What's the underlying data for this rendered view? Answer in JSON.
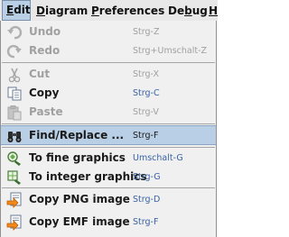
{
  "menubar": {
    "items": [
      {
        "label": "Edit",
        "mnemonic_prefix": "",
        "mnemonic": "E",
        "rest": "dit",
        "active": true
      },
      {
        "label": "Diagram",
        "mnemonic_prefix": "",
        "mnemonic": "D",
        "rest": "iagram"
      },
      {
        "label": "Preferences",
        "mnemonic_prefix": "",
        "mnemonic": "P",
        "rest": "references"
      },
      {
        "label": "Debug",
        "mnemonic_prefix": "De",
        "mnemonic": "b",
        "rest": "ug"
      },
      {
        "label": "H",
        "mnemonic_prefix": "",
        "mnemonic": "H",
        "rest": ""
      }
    ]
  },
  "menu": {
    "undo": {
      "label": "Undo",
      "accel": "Strg-Z",
      "enabled": false
    },
    "redo": {
      "label": "Redo",
      "accel": "Strg+Umschalt-Z",
      "enabled": false
    },
    "cut": {
      "label": "Cut",
      "accel": "Strg-X",
      "enabled": false
    },
    "copy": {
      "label": "Copy",
      "accel": "Strg-C",
      "enabled": true
    },
    "paste": {
      "label": "Paste",
      "accel": "Strg-V",
      "enabled": false
    },
    "find_replace": {
      "label": "Find/Replace ...",
      "accel": "Strg-F",
      "selected": true
    },
    "to_fine_graphics": {
      "label": "To fine graphics",
      "accel": "Umschalt-G"
    },
    "to_integer_graphics": {
      "label": "To integer graphics",
      "accel": "Strg-G"
    },
    "copy_png": {
      "label": "Copy PNG image",
      "accel": "Strg-D"
    },
    "copy_emf": {
      "label": "Copy EMF image",
      "accel": "Strg-F"
    }
  },
  "colors": {
    "accelerator_blue": "#3a63a5",
    "selection": "#b8cfe5",
    "disabled": "#a0a0a0"
  }
}
